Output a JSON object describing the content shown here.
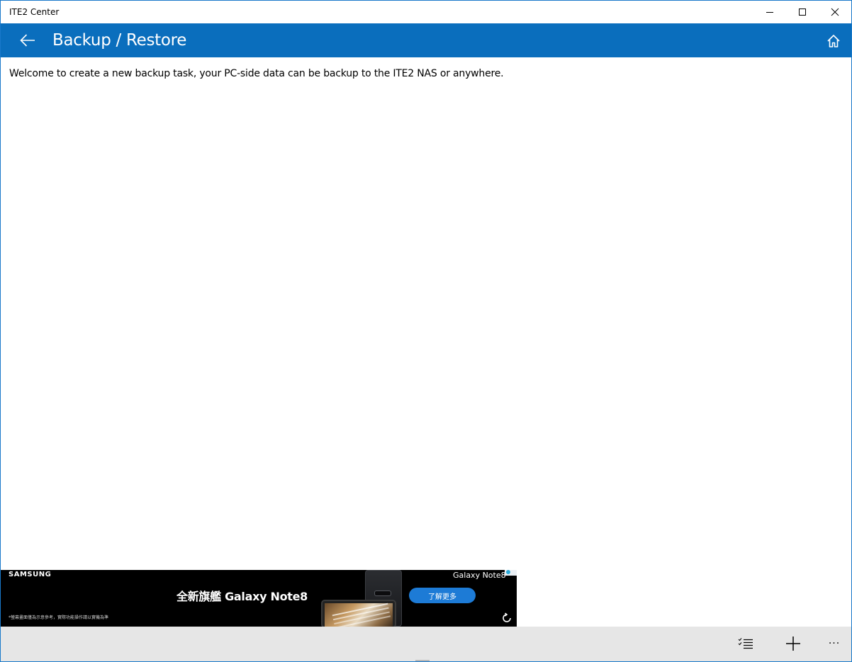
{
  "window": {
    "title": "ITE2 Center",
    "border_color": "#1979ca"
  },
  "header": {
    "title": "Backup / Restore",
    "background": "#0a6ebd",
    "back_icon": "arrow-left-icon",
    "home_icon": "home-icon"
  },
  "content": {
    "welcome_text": "Welcome to create a new backup task, your PC-side data can be backup to the ITE2 NAS or anywhere."
  },
  "ad": {
    "brand": "SAMSUNG",
    "headline": "全新旗艦 Galaxy Note8",
    "product": "Galaxy Note8",
    "cta": "了解更多",
    "disclaimer": "*螢幕畫面僅為示意參考，實際功能操作請以實機為準",
    "replay_icon": "replay-icon"
  },
  "appbar": {
    "background": "#e6e6e6",
    "buttons": [
      {
        "icon": "checklist-icon"
      },
      {
        "icon": "plus-icon"
      },
      {
        "icon": "more-ellipsis-icon",
        "label": "···"
      }
    ]
  }
}
